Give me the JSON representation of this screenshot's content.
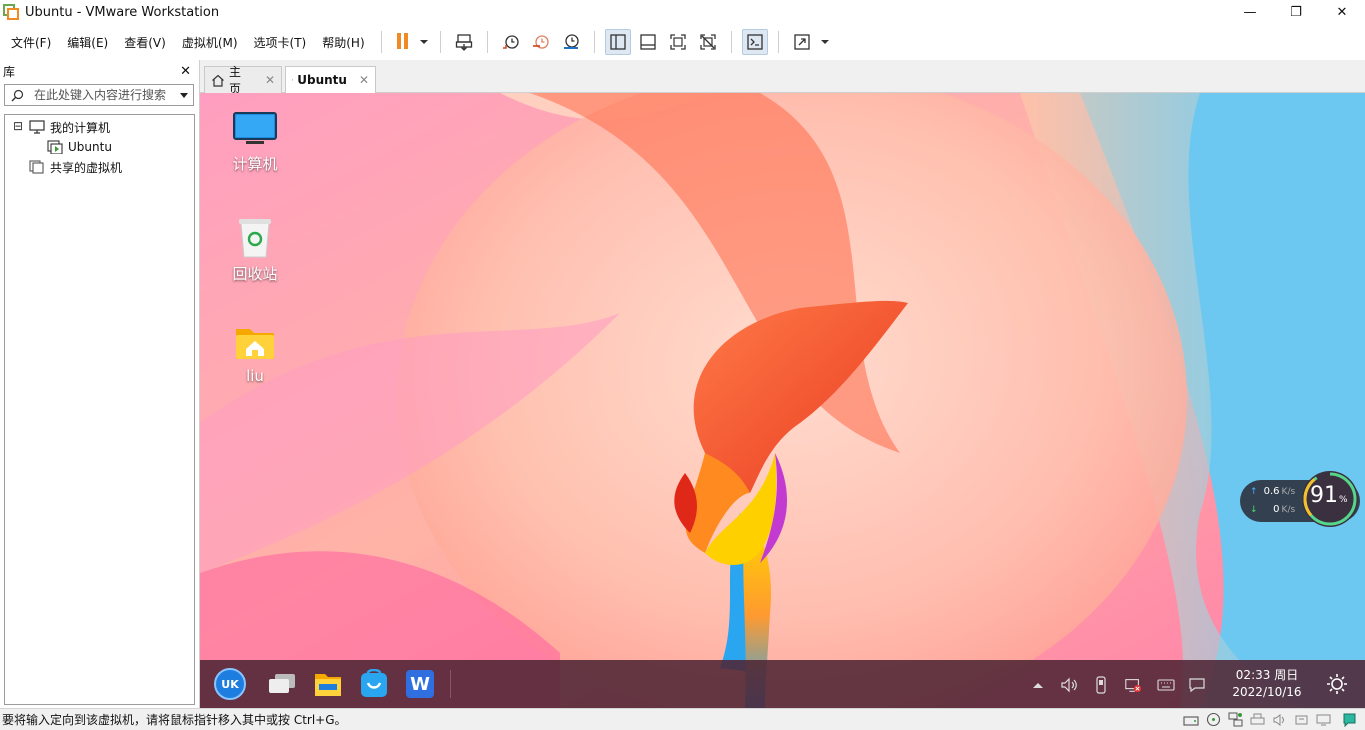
{
  "window": {
    "title": "Ubuntu - VMware Workstation",
    "controls": {
      "minimize": "—",
      "maximize": "❐",
      "close": "✕"
    }
  },
  "menu": [
    "文件(F)",
    "编辑(E)",
    "查看(V)",
    "虚拟机(M)",
    "选项卡(T)",
    "帮助(H)"
  ],
  "toolbar": {
    "icons": [
      "pause-icon",
      "send-ctrl-alt-del-icon",
      "snapshot-icon",
      "revert-snapshot-icon",
      "snapshot-manager-icon",
      "show-library-icon",
      "thumbnail-bar-icon",
      "full-screen-icon",
      "unity-icon",
      "console-view-icon",
      "stretch-icon"
    ],
    "pause_color": "#f08a24"
  },
  "library": {
    "title": "库",
    "close": "✕",
    "search_placeholder": "在此处键入内容进行搜索",
    "tree": {
      "my_computer": "我的计算机",
      "vm": "Ubuntu",
      "shared": "共享的虚拟机",
      "expander": "⊟"
    }
  },
  "tabs": [
    {
      "label": "主页",
      "close": "✕",
      "icon": "home-icon"
    },
    {
      "label": "Ubuntu",
      "close": "✕",
      "icon": "vm-icon",
      "active": true
    }
  ],
  "guest": {
    "desktop_icons": [
      {
        "label": "计算机",
        "icon": "computer-icon"
      },
      {
        "label": "回收站",
        "icon": "trash-icon"
      },
      {
        "label": "liu",
        "icon": "home-folder-icon"
      }
    ],
    "taskbar": {
      "apps": [
        "start-menu-icon",
        "multitask-view-icon",
        "file-manager-icon",
        "software-store-icon",
        "wps-writer-icon"
      ],
      "tray": [
        "tray-expand-icon",
        "volume-icon",
        "usb-icon",
        "network-icon",
        "keyboard-icon",
        "notification-icon"
      ],
      "time": "02:33 周日",
      "date": "2022/10/16",
      "wk_logo": "UK",
      "wps_letter": "W"
    },
    "net_widget": {
      "up": "0.6",
      "down": "0",
      "unit": "K/s",
      "usage": "91",
      "usage_unit": "%",
      "up_arrow": "↑",
      "down_arrow": "↓"
    }
  },
  "status": {
    "message": "要将输入定向到该虚拟机，请将鼠标指针移入其中或按 Ctrl+G。",
    "icons": [
      "hdd-icon",
      "cdrom-icon",
      "network-adapter-icon",
      "printer-icon",
      "sound-icon",
      "usb-device-icon",
      "display-icon",
      "message-icon"
    ]
  }
}
